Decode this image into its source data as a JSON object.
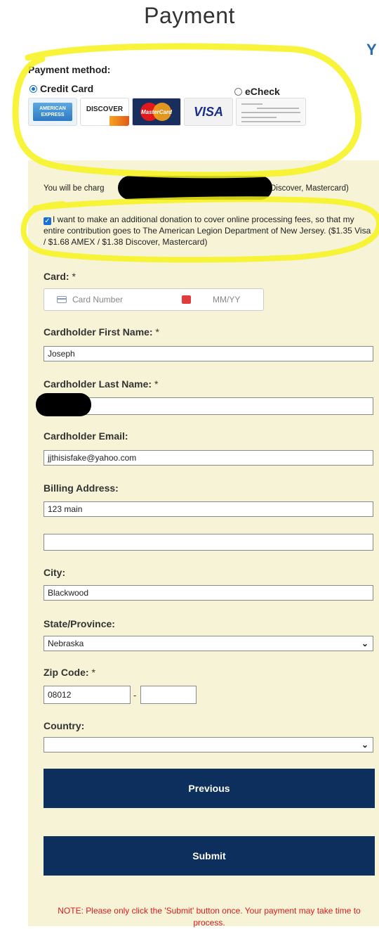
{
  "page": {
    "title": "Payment",
    "corner_mark": "Y"
  },
  "payment_method": {
    "label": "Payment method:",
    "options": [
      {
        "label": "Credit Card",
        "selected": true
      },
      {
        "label": "eCheck",
        "selected": false
      }
    ],
    "card_logos": [
      {
        "name": "amex-logo",
        "text": "AMERICAN EXPRESS"
      },
      {
        "name": "discover-logo",
        "text": "DISCOVER"
      },
      {
        "name": "mastercard-logo",
        "text": "MasterCard"
      },
      {
        "name": "visa-logo",
        "text": "VISA"
      },
      {
        "name": "echeck-logo",
        "text": ""
      }
    ]
  },
  "charge_notice": {
    "text_start": "You will be charg",
    "text_end": "Discover, Mastercard)"
  },
  "donation": {
    "checked": true,
    "text": "I want to make an additional donation to cover online processing fees, so that my entire contribution goes to The American Legion Department of New Jersey. ($1.35 Visa / $1.68 AMEX / $1.38 Discover, Mastercard)"
  },
  "form": {
    "card_label": "Card:",
    "required_mark": "*",
    "card_number_placeholder": "Card Number",
    "expiry_placeholder": "MM/YY",
    "first_name_label": "Cardholder First Name:",
    "first_name_value": "Joseph",
    "last_name_label": "Cardholder Last Name:",
    "last_name_value": "",
    "email_label": "Cardholder Email:",
    "email_value": "jjthisisfake@yahoo.com",
    "billing_label": "Billing Address:",
    "address1_value": "123 main",
    "address2_value": "",
    "city_label": "City:",
    "city_value": "Blackwood",
    "state_label": "State/Province:",
    "state_value": "Nebraska",
    "zip_label": "Zip Code:",
    "zip_value": "08012",
    "zip_separator": "-",
    "zip_ext_value": "",
    "country_label": "Country:",
    "country_value": ""
  },
  "buttons": {
    "previous": "Previous",
    "submit": "Submit"
  },
  "note": "NOTE: Please only click the 'Submit' button once. Your payment may take time to process.",
  "colors": {
    "panel": "#f6f3d6",
    "button": "#0d2f5e",
    "highlight": "#f7f21a",
    "note": "#e0191c"
  }
}
